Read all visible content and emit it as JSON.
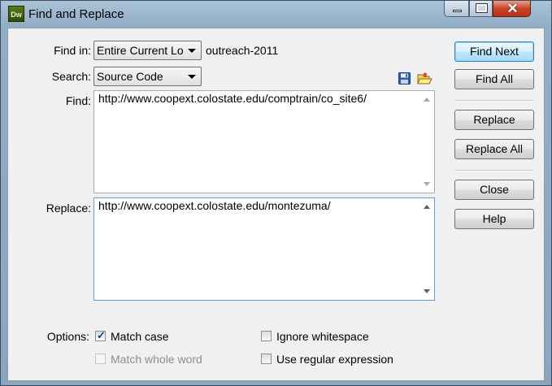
{
  "window": {
    "title": "Find and Replace",
    "app_icon_text": "Dw",
    "controls": {
      "minimize": "minimize-icon",
      "maximize": "maximize-icon",
      "close": "close-icon"
    }
  },
  "find_in": {
    "label": "Find in:",
    "selected": "Entire Current Lo",
    "site_name": "outreach-2011"
  },
  "search": {
    "label": "Search:",
    "selected": "Source Code"
  },
  "find": {
    "label": "Find:",
    "value": "http://www.coopext.colostate.edu/comptrain/co_site6/"
  },
  "replace": {
    "label": "Replace:",
    "value": "http://www.coopext.colostate.edu/montezuma/"
  },
  "buttons": {
    "find_next": "Find Next",
    "find_all": "Find All",
    "replace": "Replace",
    "replace_all": "Replace All",
    "close": "Close",
    "help": "Help"
  },
  "options": {
    "label": "Options:",
    "match_case": {
      "label": "Match case",
      "checked": true
    },
    "match_whole_word": {
      "label": "Match whole word",
      "checked": false,
      "disabled": true
    },
    "ignore_whitespace": {
      "label": "Ignore whitespace",
      "checked": false
    },
    "use_regex": {
      "label": "Use regular expression",
      "checked": false
    }
  },
  "icons": {
    "save_query": "save-query-icon",
    "load_query": "load-query-icon"
  }
}
